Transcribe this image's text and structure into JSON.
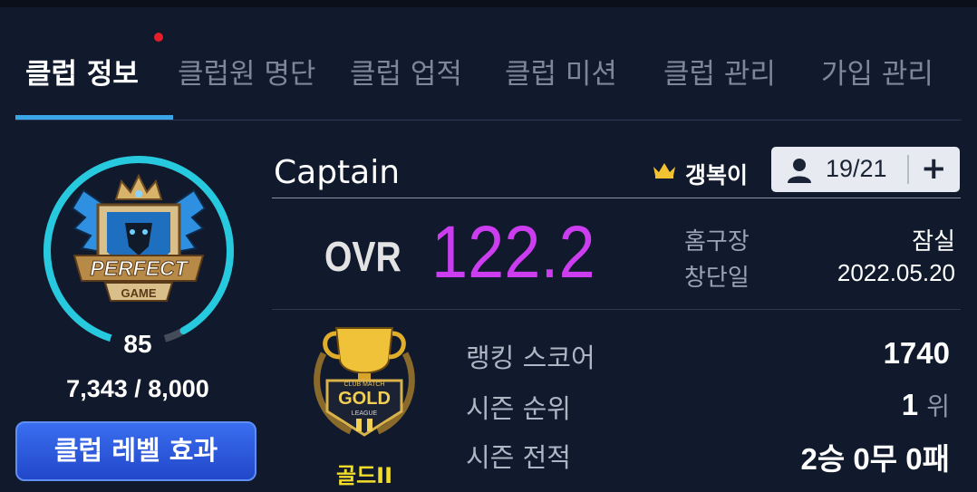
{
  "tabs": [
    {
      "label": "클럽 정보",
      "active": true
    },
    {
      "label": "클럽원 명단",
      "active": false
    },
    {
      "label": "클럽 업적",
      "active": false
    },
    {
      "label": "클럽 미션",
      "active": false
    },
    {
      "label": "클럽 관리",
      "active": false
    },
    {
      "label": "가입 관리",
      "active": false
    }
  ],
  "club": {
    "emblem_text": "PERFECT",
    "emblem_subtext": "GAME",
    "level": "85",
    "exp_text": "7,343 / 8,000",
    "exp_progress": 0.918,
    "level_effect_button": "클럽 레벨 효과",
    "name": "Captain",
    "owner": "갱복이",
    "member_count": "19/21",
    "ovr_label": "OVR",
    "ovr_value": "122.2"
  },
  "info": {
    "home_label": "홈구장",
    "home_value": "잠실",
    "founded_label": "창단일",
    "founded_value": "2022.05.20"
  },
  "tier": {
    "badge_text": "GOLD",
    "badge_small": "CLUB MATCH",
    "badge_bottom": "LEAGUE",
    "name": "골드II"
  },
  "stats": {
    "ranking_label": "랭킹 스코어",
    "ranking_value": "1740",
    "season_rank_label": "시즌 순위",
    "season_rank_value": "1",
    "season_rank_unit": "위",
    "season_record_label": "시즌 전적",
    "season_record_value": "2승 0무 0패"
  },
  "colors": {
    "background": "#101a2c",
    "tab_underline": "#3aa6e8",
    "ovr": "#cc3df0",
    "level_ring": "#27c9de",
    "tier_name": "#f2dc2a",
    "button": "#2b57d8"
  }
}
